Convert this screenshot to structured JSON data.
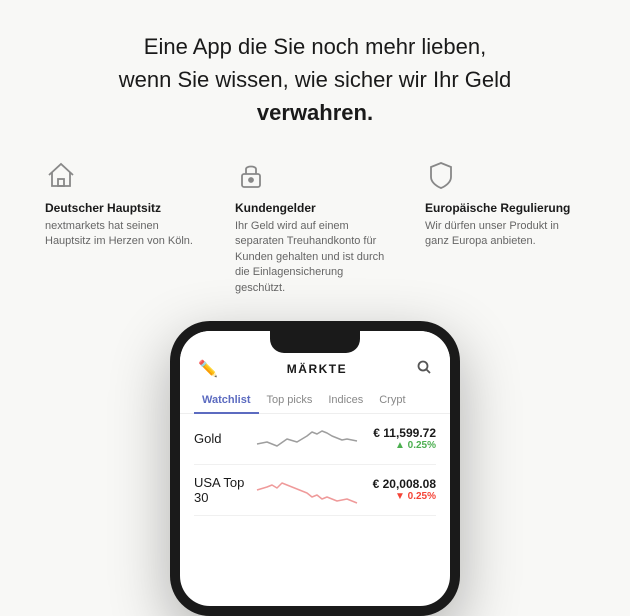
{
  "hero": {
    "line1": "Eine App die Sie noch mehr lieben,",
    "line2": "wenn Sie wissen, wie sicher wir Ihr Geld",
    "line3": "verwahren."
  },
  "features": [
    {
      "id": "hauptsitz",
      "icon": "house",
      "title": "Deutscher Hauptsitz",
      "description": "nextmarkets hat seinen Hauptsitz im Herzen von Köln."
    },
    {
      "id": "kundengelder",
      "icon": "lock",
      "title": "Kundengelder",
      "description": "Ihr Geld wird auf einem separaten Treuhandkonto für Kunden gehalten und ist durch die Einlagensicherung geschützt."
    },
    {
      "id": "regulierung",
      "icon": "shield",
      "title": "Europäische Regulierung",
      "description": "Wir dürfen unser Produkt in ganz Europa anbieten."
    }
  ],
  "app": {
    "header_title": "MÄRKTE",
    "tabs": [
      "Watchlist",
      "Top picks",
      "Indices",
      "Crypt"
    ],
    "active_tab": "Watchlist",
    "stocks": [
      {
        "name": "Gold",
        "price": "€ 11,599.72",
        "change": "▲ 0.25%",
        "change_type": "up"
      },
      {
        "name": "USA Top 30",
        "price": "€ 20,008.08",
        "change": "▼ 0.25%",
        "change_type": "down"
      }
    ]
  }
}
